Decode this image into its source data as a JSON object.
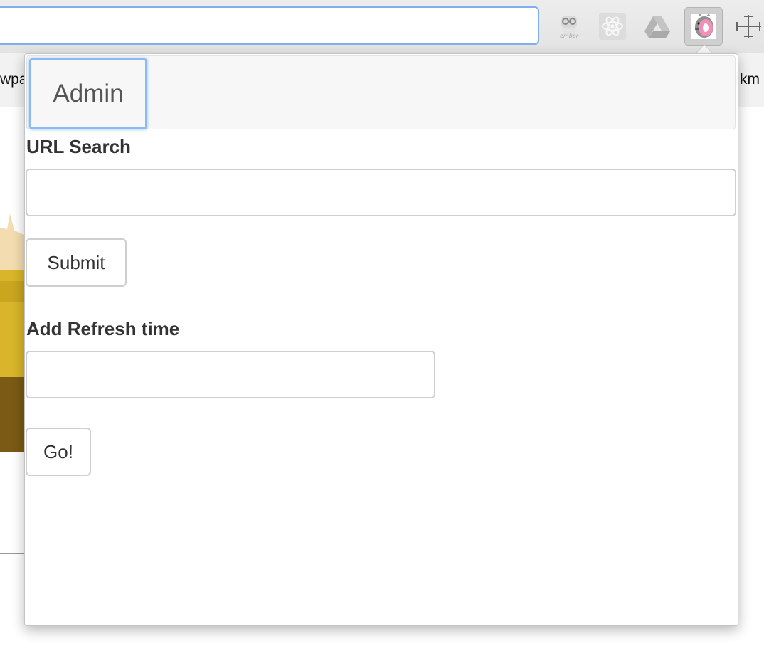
{
  "browser": {
    "extensions": [
      {
        "name": "ember-inspector-icon"
      },
      {
        "name": "react-devtools-icon"
      },
      {
        "name": "google-drive-icon"
      },
      {
        "name": "pusheen-extension-icon",
        "active": true
      },
      {
        "name": "page-ruler-icon"
      }
    ],
    "bookmarks_bar": {
      "left_fragment": "wpa",
      "right_fragment": "km"
    }
  },
  "popup": {
    "header": {
      "tab_label": "Admin"
    },
    "url_search": {
      "label": "URL Search",
      "value": "",
      "placeholder": ""
    },
    "submit_label": "Submit",
    "refresh": {
      "label": "Add Refresh time",
      "value": "",
      "placeholder": ""
    },
    "go_label": "Go!"
  },
  "colors": {
    "focus_ring": "#8dbaf5",
    "address_focus": "#7fb0ec"
  }
}
